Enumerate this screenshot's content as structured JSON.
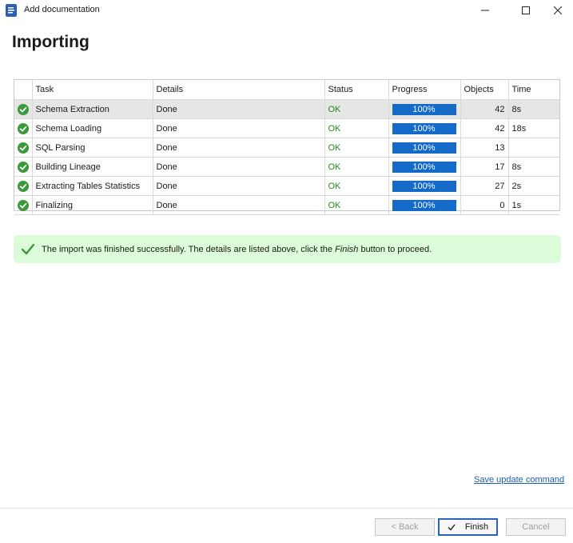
{
  "window": {
    "title": "Add documentation",
    "heading": "Importing"
  },
  "table": {
    "columns": [
      "Task",
      "Details",
      "Status",
      "Progress",
      "Objects",
      "Time"
    ],
    "rows": [
      {
        "task": "Schema Extraction",
        "details": "Done",
        "status": "OK",
        "progress": 100,
        "progress_label": "100%",
        "objects": "42",
        "time": "8s"
      },
      {
        "task": "Schema Loading",
        "details": "Done",
        "status": "OK",
        "progress": 100,
        "progress_label": "100%",
        "objects": "42",
        "time": "18s"
      },
      {
        "task": "SQL Parsing",
        "details": "Done",
        "status": "OK",
        "progress": 100,
        "progress_label": "100%",
        "objects": "13",
        "time": ""
      },
      {
        "task": "Building Lineage",
        "details": "Done",
        "status": "OK",
        "progress": 100,
        "progress_label": "100%",
        "objects": "17",
        "time": "8s"
      },
      {
        "task": "Extracting Tables Statistics",
        "details": "Done",
        "status": "OK",
        "progress": 100,
        "progress_label": "100%",
        "objects": "27",
        "time": "2s"
      },
      {
        "task": "Finalizing",
        "details": "Done",
        "status": "OK",
        "progress": 100,
        "progress_label": "100%",
        "objects": "0",
        "time": "1s"
      }
    ]
  },
  "banner": {
    "text_before": "The import was finished successfully. The details are listed above, click the ",
    "text_emph": "Finish",
    "text_after": " button to proceed."
  },
  "links": {
    "save_update_command": "Save update command"
  },
  "buttons": {
    "back": "< Back",
    "finish": "Finish",
    "cancel": "Cancel"
  },
  "colors": {
    "progress": "#1569c7",
    "ok_text": "#1f8a1f",
    "success_icon": "#3a9a3a",
    "banner_bg": "#dcfbd8",
    "link": "#1a5fb4"
  }
}
